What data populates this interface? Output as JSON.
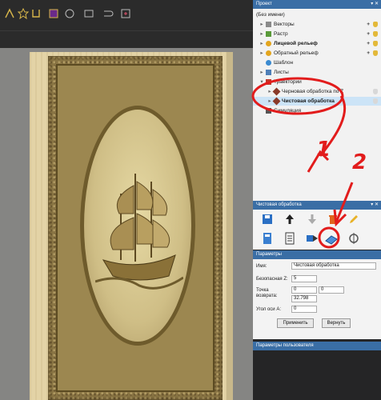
{
  "project": {
    "title": "Проект",
    "root": "(Без имени)",
    "items": [
      {
        "label": "Векторы"
      },
      {
        "label": "Растр"
      },
      {
        "label": "Лицевой рельеф"
      },
      {
        "label": "Обратный рельеф"
      },
      {
        "label": "Шаблон"
      },
      {
        "label": "Листы"
      },
      {
        "label": "Траектории"
      },
      {
        "label": "Черновая обработка по Z"
      },
      {
        "label": "Чистовая обработка"
      },
      {
        "label": "Симуляция"
      }
    ]
  },
  "tool_panel": {
    "title": "Чистовая обработка"
  },
  "params": {
    "title": "Параметры",
    "name_label": "Имя:",
    "name_value": "Чистовая обработка",
    "safe_z_label": "Безопасная Z:",
    "safe_z_value": "5",
    "return_label": "Точка возврата:",
    "return_x": "0",
    "return_y": "0",
    "return_z": "32.798",
    "angle_label": "Угол оси A:",
    "angle_value": "0",
    "apply_label": "Применить",
    "revert_label": "Вернуть"
  },
  "user_params": {
    "title": "Параметры пользователя"
  },
  "annotations": {
    "one": "1",
    "two": "2"
  },
  "colors": {
    "accent": "#3a6ea5",
    "annotation": "#e21c1c",
    "tree_selection": "#cce4f7"
  }
}
